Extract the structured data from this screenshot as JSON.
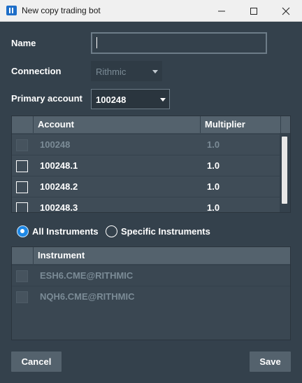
{
  "window": {
    "title": "New copy trading bot"
  },
  "form": {
    "name_label": "Name",
    "name_value": "",
    "connection_label": "Connection",
    "connection_value": "Rithmic",
    "primary_account_label": "Primary account",
    "primary_account_value": "100248"
  },
  "accounts_grid": {
    "columns": [
      "Account",
      "Multiplier"
    ],
    "rows": [
      {
        "account": "100248",
        "multiplier": "1.0",
        "checked": false,
        "disabled": true
      },
      {
        "account": "100248.1",
        "multiplier": "1.0",
        "checked": false,
        "disabled": false
      },
      {
        "account": "100248.2",
        "multiplier": "1.0",
        "checked": false,
        "disabled": false
      },
      {
        "account": "100248.3",
        "multiplier": "1.0",
        "checked": false,
        "disabled": false
      }
    ]
  },
  "instrument_filter": {
    "all_label": "All Instruments",
    "specific_label": "Specific Instruments",
    "selected": "all"
  },
  "instruments_grid": {
    "columns": [
      "Instrument"
    ],
    "rows": [
      {
        "instrument": "ESH6.CME@RITHMIC",
        "checked": false,
        "disabled": true
      },
      {
        "instrument": "NQH6.CME@RITHMIC",
        "checked": false,
        "disabled": true
      }
    ]
  },
  "buttons": {
    "cancel_label": "Cancel",
    "save_label": "Save"
  },
  "colors": {
    "background": "#34414c",
    "header": "#54626d",
    "accent": "#1e88e5"
  }
}
